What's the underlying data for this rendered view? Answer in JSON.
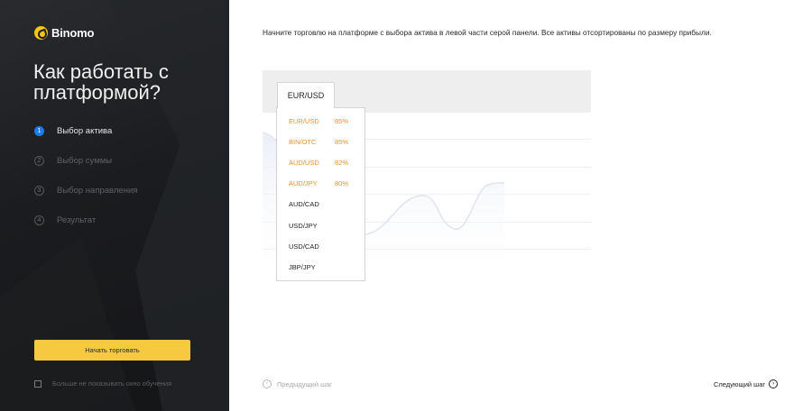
{
  "brand": {
    "name": "Binomo",
    "accent": "#f5c518"
  },
  "sidebar": {
    "title": "Как работать с платформой?",
    "steps": [
      {
        "num": "1",
        "label": "Выбор актива",
        "active": true
      },
      {
        "num": "2",
        "label": "Выбор суммы",
        "active": false
      },
      {
        "num": "3",
        "label": "Выбор направления",
        "active": false
      },
      {
        "num": "4",
        "label": "Результат",
        "active": false
      }
    ],
    "start_button": "Начать торговать",
    "dont_show_label": "Больше не показывать окно обучения"
  },
  "main": {
    "instruction": "Начните торговлю на платформе с выбора актива в левой части серой панели. Все активы отсортированы по размеру прибыли.",
    "selected_asset": "EUR/USD",
    "assets": [
      {
        "name": "EUR/USD",
        "profit": "85%"
      },
      {
        "name": "BIN/OTC",
        "profit": "85%"
      },
      {
        "name": "AUD/USD",
        "profit": "82%"
      },
      {
        "name": "AUD/JPY",
        "profit": "80%"
      },
      {
        "name": "AUD/CAD",
        "profit": ""
      },
      {
        "name": "USD/JPY",
        "profit": ""
      },
      {
        "name": "USD/CAD",
        "profit": ""
      },
      {
        "name": "JBP/JPY",
        "profit": ""
      }
    ],
    "prev_label": "Предыдущий шаг",
    "next_label": "Следующий шаг"
  },
  "colors": {
    "active_step": "#1d7cf2",
    "start_button": "#f7c941",
    "profit_highlight": "#f0922a"
  },
  "icons": {
    "prev": "chevron-left-circle-icon",
    "next": "chevron-right-circle-icon",
    "logo": "binomo-logo-icon"
  }
}
